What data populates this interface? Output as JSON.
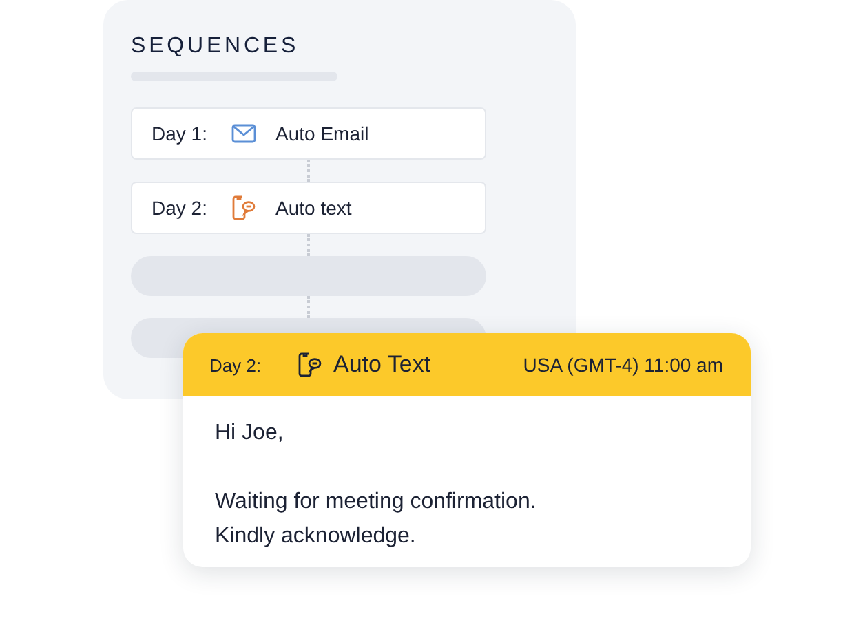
{
  "panel": {
    "title": "SEQUENCES",
    "steps": [
      {
        "kind": "email",
        "day": "Day 1:",
        "label": "Auto Email"
      },
      {
        "kind": "text",
        "day": "Day 2:",
        "label": "Auto text"
      },
      {
        "kind": "placeholder"
      },
      {
        "kind": "placeholder"
      }
    ]
  },
  "popup": {
    "kind": "text",
    "day": "Day 2:",
    "title": "Auto Text",
    "schedule": "USA (GMT-4) 11:00 am",
    "paragraphs": [
      "Hi Joe,",
      "Waiting for meeting confirmation.\nKindly acknowledge."
    ]
  }
}
